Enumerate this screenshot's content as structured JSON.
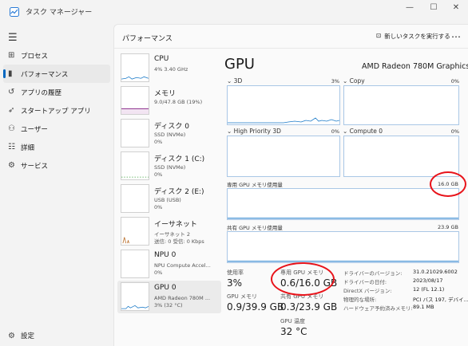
{
  "window": {
    "title": "タスク マネージャー",
    "minimize": "—",
    "maximize": "☐",
    "close": "✕"
  },
  "nav": {
    "menu_icon": "☰",
    "items": [
      {
        "label": "プロセス",
        "icon": "⊞"
      },
      {
        "label": "パフォーマンス",
        "icon": "▮"
      },
      {
        "label": "アプリの履歴",
        "icon": "↺"
      },
      {
        "label": "スタートアップ アプリ",
        "icon": "➶"
      },
      {
        "label": "ユーザー",
        "icon": "⚇"
      },
      {
        "label": "詳細",
        "icon": "☷"
      },
      {
        "label": "サービス",
        "icon": "⚙"
      }
    ],
    "settings_label": "設定",
    "settings_icon": "⚙"
  },
  "header": {
    "title": "パフォーマンス",
    "new_task_label": "新しいタスクを実行する",
    "new_task_icon": "⊡",
    "more_icon": "…"
  },
  "devices": [
    {
      "name": "CPU",
      "line1": "4% 3.40 GHz",
      "line2": ""
    },
    {
      "name": "メモリ",
      "line1": "9.0/47.8 GB (19%)",
      "line2": ""
    },
    {
      "name": "ディスク 0",
      "line1": "SSD (NVMe)",
      "line2": "0%"
    },
    {
      "name": "ディスク 1 (C:)",
      "line1": "SSD (NVMe)",
      "line2": "0%"
    },
    {
      "name": "ディスク 2 (E:)",
      "line1": "USB (USB)",
      "line2": "0%"
    },
    {
      "name": "イーサネット",
      "line1": "イーサネット 2",
      "line2": "送信: 0 受信: 0 Kbps"
    },
    {
      "name": "NPU 0",
      "line1": "NPU Compute Accel...",
      "line2": "0%"
    },
    {
      "name": "GPU 0",
      "line1": "AMD Radeon 780M ...",
      "line2": "3% (32 °C)"
    }
  ],
  "gpu": {
    "title": "GPU",
    "model": "AMD Radeon 780M Graphics",
    "engines": [
      {
        "label": "3D",
        "pct": "3%"
      },
      {
        "label": "Copy",
        "pct": "0%"
      },
      {
        "label": "High Priority 3D",
        "pct": "0%"
      },
      {
        "label": "Compute 0",
        "pct": "0%"
      }
    ],
    "dedicated_label": "専用 GPU メモリ使用量",
    "dedicated_max": "16.0 GB",
    "shared_label": "共有 GPU メモリ使用量",
    "shared_max": "23.9 GB",
    "stats": {
      "usage_label": "使用率",
      "usage": "3%",
      "dedicated_mem_label": "専用 GPU メモリ",
      "dedicated_mem": "0.6/16.0 GB",
      "gpu_mem_label": "GPU メモリ",
      "gpu_mem": "0.9/39.9 GB",
      "shared_mem_label": "共有 GPU メモリ",
      "shared_mem": "0.3/23.9 GB",
      "temp_label": "GPU 温度",
      "temp": "32 °C"
    },
    "info": [
      {
        "k": "ドライバーのバージョン:",
        "v": "31.0.21029.6002"
      },
      {
        "k": "ドライバーの日付:",
        "v": "2023/08/17"
      },
      {
        "k": "DirectX バージョン:",
        "v": "12 (FL 12.1)"
      },
      {
        "k": "物理的な場所:",
        "v": "PCI バス 197, デバイ..."
      },
      {
        "k": "ハードウェア予約済みメモリ:",
        "v": "89.1 MB"
      }
    ]
  },
  "colors": {
    "accent": "#0067c0",
    "graph_line": "#1a7ac8",
    "annotation": "#e8131a"
  }
}
